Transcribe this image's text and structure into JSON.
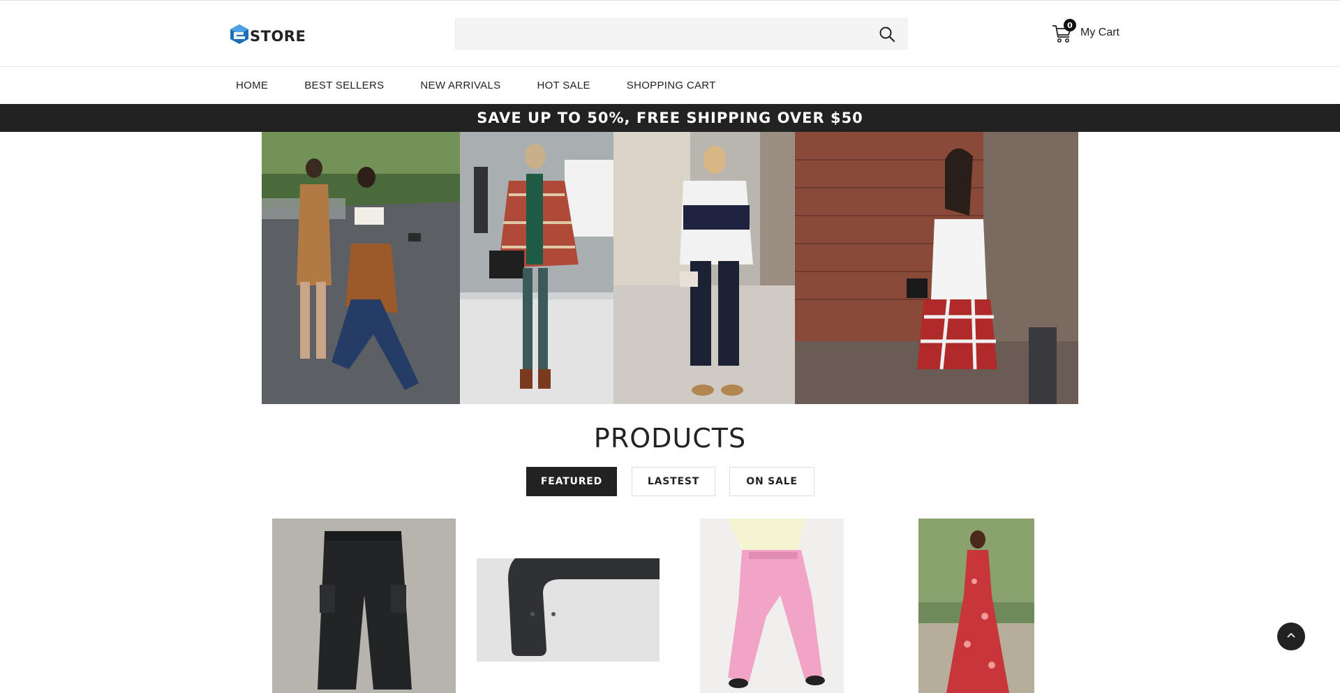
{
  "header": {
    "logo_text": "STORE",
    "search": {
      "placeholder": "",
      "value": ""
    },
    "cart": {
      "count": "0",
      "label": "My Cart"
    }
  },
  "nav": {
    "items": [
      {
        "label": "HOME"
      },
      {
        "label": "BEST SELLERS"
      },
      {
        "label": "NEW ARRIVALS"
      },
      {
        "label": "HOT SALE"
      },
      {
        "label": "SHOPPING CART"
      }
    ]
  },
  "promo": {
    "text": "SAVE UP TO 50%, FREE SHIPPING OVER $50"
  },
  "products": {
    "title": "PRODUCTS",
    "tabs": [
      {
        "label": "FEATURED",
        "active": true
      },
      {
        "label": "LASTEST",
        "active": false
      },
      {
        "label": "ON SALE",
        "active": false
      }
    ]
  },
  "colors": {
    "dark": "#222222",
    "promo_bg": "#222222",
    "search_bg": "#f4f4f4",
    "logo_blue": "#1f6fb5"
  },
  "icons": {
    "search": "search-icon",
    "cart": "shopping-cart-icon",
    "scroll_top": "chevron-up-icon",
    "logo": "cube-logo-icon"
  }
}
